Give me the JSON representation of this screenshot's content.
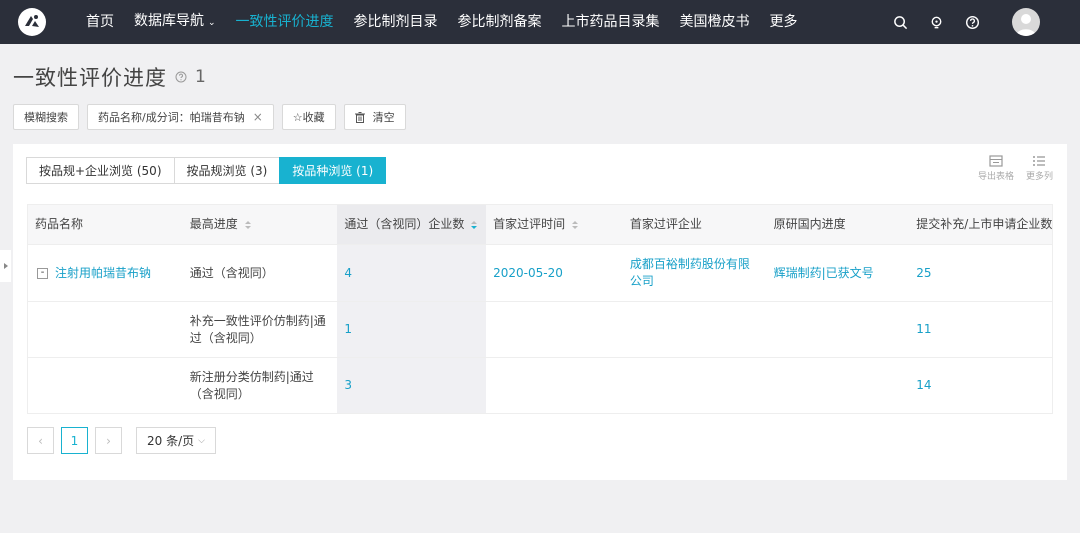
{
  "nav": {
    "items": [
      {
        "label": "首页",
        "active": false
      },
      {
        "label": "数据库导航",
        "active": false,
        "dropdown": true
      },
      {
        "label": "一致性评价进度",
        "active": true
      },
      {
        "label": "参比制剂目录",
        "active": false
      },
      {
        "label": "参比制剂备案",
        "active": false
      },
      {
        "label": "上市药品目录集",
        "active": false
      },
      {
        "label": "美国橙皮书",
        "active": false
      },
      {
        "label": "更多",
        "active": false
      }
    ],
    "icons": [
      "search-icon",
      "lightbulb-icon",
      "help-icon",
      "avatar"
    ]
  },
  "page": {
    "title": "一致性评价进度",
    "count": "1"
  },
  "filters": {
    "fuzzy_label": "模糊搜索",
    "tag_label": "药品名称/成分词：帕瑞昔布钠",
    "tag_close": "×",
    "favorite_label": "☆收藏",
    "clear_label": "清空"
  },
  "view_tabs": [
    {
      "label": "按品规+企业浏览 (50)",
      "active": false
    },
    {
      "label": "按品规浏览 (3)",
      "active": false
    },
    {
      "label": "按品种浏览 (1)",
      "active": true
    }
  ],
  "tools": {
    "export_label": "导出表格",
    "more_cols_label": "更多列"
  },
  "table": {
    "headers": [
      "药品名称",
      "最高进度",
      "通过（含视同）企业数",
      "首家过评时间",
      "首家过评企业",
      "原研国内进度",
      "提交补充/上市申请企业数"
    ],
    "rows": [
      {
        "expand": "-",
        "name": "注射用帕瑞昔布钠",
        "progress": "通过（含视同）",
        "passed_count": "4",
        "first_time": "2020-05-20",
        "first_company": "成都百裕制药股份有限公司",
        "original": "辉瑞制药|已获文号",
        "applicants": "25"
      },
      {
        "expand": "",
        "name": "",
        "progress": "补充一致性评价仿制药|通过（含视同）",
        "passed_count": "1",
        "first_time": "",
        "first_company": "",
        "original": "",
        "applicants": "11"
      },
      {
        "expand": "",
        "name": "",
        "progress": "新注册分类仿制药|通过（含视同）",
        "passed_count": "3",
        "first_time": "",
        "first_company": "",
        "original": "",
        "applicants": "14"
      }
    ]
  },
  "pager": {
    "prev": "‹",
    "current": "1",
    "next": "›",
    "page_size": "20 条/页"
  },
  "colors": {
    "accent": "#18b2d0",
    "nav_bg": "#2b2f3a",
    "link": "#18a0c8"
  }
}
